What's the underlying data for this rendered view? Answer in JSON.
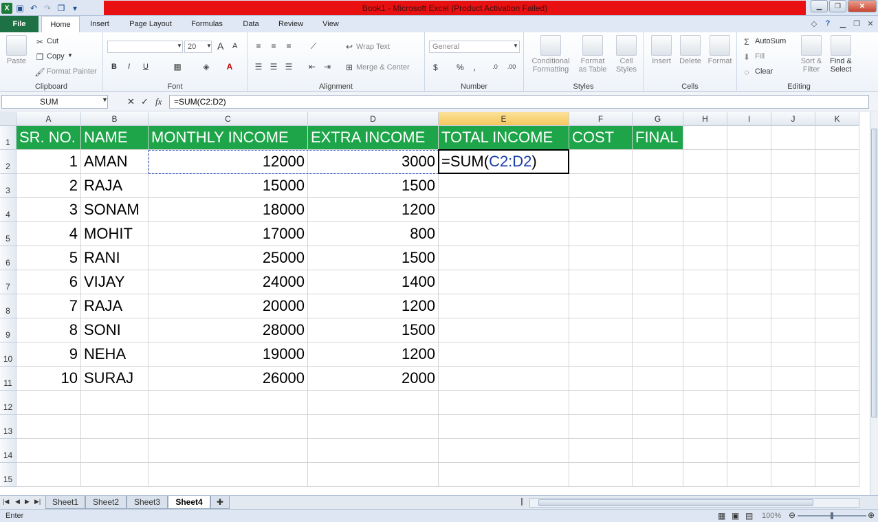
{
  "title_bar": {
    "title": "Book1  -  Microsoft Excel (Product Activation Failed)",
    "colors": {
      "title_bg": "#e81010",
      "window_bg": "#dde6f2"
    }
  },
  "tabs": {
    "file": "File",
    "items": [
      "Home",
      "Insert",
      "Page Layout",
      "Formulas",
      "Data",
      "Review",
      "View"
    ],
    "active": "Home"
  },
  "ribbon": {
    "clipboard": {
      "paste": "Paste",
      "cut": "Cut",
      "copy": "Copy",
      "format_painter": "Format Painter",
      "label": "Clipboard"
    },
    "font": {
      "name": "",
      "size": "20",
      "bold": "B",
      "italic": "I",
      "underline": "U",
      "grow": "A",
      "shrink": "A",
      "label": "Font"
    },
    "alignment": {
      "wrap_text": "Wrap Text",
      "merge_center": "Merge & Center",
      "label": "Alignment"
    },
    "number": {
      "format": "General",
      "currency": "$",
      "percent": "%",
      "comma": ",",
      "label": "Number"
    },
    "styles": {
      "conditional": "Conditional",
      "conditional2": "Formatting",
      "format_table": "Format",
      "format_table2": "as Table",
      "cell_styles": "Cell",
      "cell_styles2": "Styles",
      "label": "Styles"
    },
    "cells": {
      "insert": "Insert",
      "delete": "Delete",
      "format": "Format",
      "label": "Cells"
    },
    "editing": {
      "autosum": "AutoSum",
      "fill": "Fill",
      "clear": "Clear",
      "sort": "Sort &",
      "sort2": "Filter",
      "find": "Find &",
      "find2": "Select",
      "label": "Editing"
    }
  },
  "formula_bar": {
    "name_box": "SUM",
    "fx": "fx",
    "cancel": "✕",
    "enter": "✓",
    "formula": "=SUM(C2:D2)"
  },
  "grid": {
    "columns": [
      "A",
      "B",
      "C",
      "D",
      "E",
      "F",
      "G",
      "H",
      "I",
      "J",
      "K"
    ],
    "selected_column": "E",
    "rows": [
      "1",
      "2",
      "3",
      "4",
      "5",
      "6",
      "7",
      "8",
      "9",
      "10",
      "11",
      "12",
      "13",
      "14",
      "15"
    ],
    "header_bg": "#1ea54a",
    "headers": [
      "SR. NO.",
      "NAME",
      "MONTHLY INCOME",
      "EXTRA INCOME",
      "TOTAL INCOME",
      "COST",
      "FINAL"
    ],
    "data": [
      {
        "sr": "1",
        "name": "AMAN",
        "monthly": "12000",
        "extra": "3000"
      },
      {
        "sr": "2",
        "name": "RAJA",
        "monthly": "15000",
        "extra": "1500"
      },
      {
        "sr": "3",
        "name": "SONAM",
        "monthly": "18000",
        "extra": "1200"
      },
      {
        "sr": "4",
        "name": "MOHIT",
        "monthly": "17000",
        "extra": "800"
      },
      {
        "sr": "5",
        "name": "RANI",
        "monthly": "25000",
        "extra": "1500"
      },
      {
        "sr": "6",
        "name": "VIJAY",
        "monthly": "24000",
        "extra": "1400"
      },
      {
        "sr": "7",
        "name": "RAJA",
        "monthly": "20000",
        "extra": "1200"
      },
      {
        "sr": "8",
        "name": "SONI",
        "monthly": "28000",
        "extra": "1500"
      },
      {
        "sr": "9",
        "name": "NEHA",
        "monthly": "19000",
        "extra": "1200"
      },
      {
        "sr": "10",
        "name": "SURAJ",
        "monthly": "26000",
        "extra": "2000"
      }
    ],
    "editing_cell": {
      "prefix": "=SUM(",
      "ref": "C2:D2",
      "suffix": ")"
    }
  },
  "sheets": {
    "items": [
      "Sheet1",
      "Sheet2",
      "Sheet3",
      "Sheet4"
    ],
    "active": "Sheet4"
  },
  "status": {
    "mode": "Enter",
    "zoom": "100%"
  }
}
